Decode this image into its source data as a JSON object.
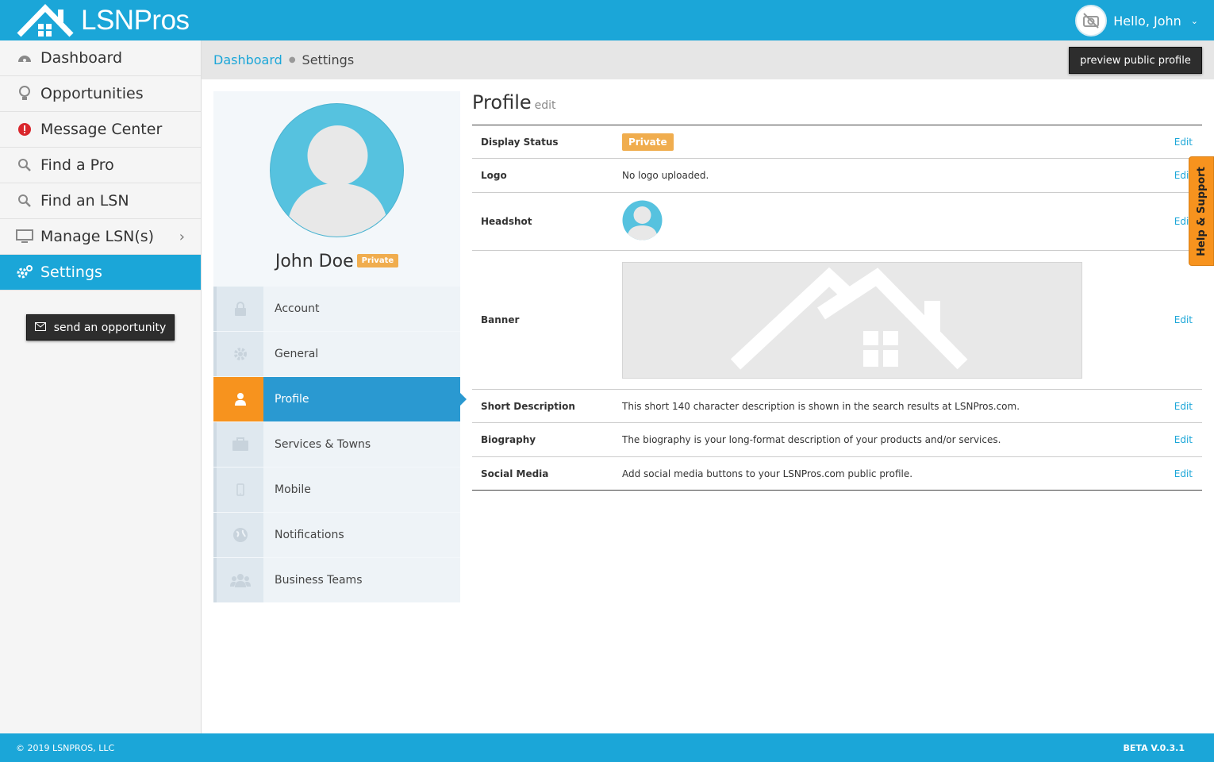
{
  "brand": {
    "name": "LSNPros"
  },
  "header": {
    "greeting": "Hello, John"
  },
  "sidebar": {
    "items": [
      {
        "label": "Dashboard",
        "icon": "dashboard-icon"
      },
      {
        "label": "Opportunities",
        "icon": "lightbulb-icon"
      },
      {
        "label": "Message Center",
        "icon": "alert-icon"
      },
      {
        "label": "Find a Pro",
        "icon": "search-icon"
      },
      {
        "label": "Find an LSN",
        "icon": "search-icon"
      },
      {
        "label": "Manage LSN(s)",
        "icon": "monitor-icon"
      },
      {
        "label": "Settings",
        "icon": "gears-icon",
        "active": true
      }
    ],
    "send_button": "send an opportunity"
  },
  "breadcrumb": {
    "parent": "Dashboard",
    "current": "Settings"
  },
  "preview_button": "preview public profile",
  "profile_panel": {
    "name": "John Doe",
    "status_badge": "Private",
    "menu": [
      {
        "label": "Account",
        "icon": "lock-icon"
      },
      {
        "label": "General",
        "icon": "gear-icon"
      },
      {
        "label": "Profile",
        "icon": "user-icon",
        "active": true
      },
      {
        "label": "Services & Towns",
        "icon": "briefcase-icon"
      },
      {
        "label": "Mobile",
        "icon": "mobile-icon"
      },
      {
        "label": "Notifications",
        "icon": "globe-icon"
      },
      {
        "label": "Business Teams",
        "icon": "users-icon"
      }
    ]
  },
  "content": {
    "title": "Profile",
    "title_edit": "edit",
    "edit_label": "Edit",
    "rows": {
      "display_status": {
        "label": "Display Status",
        "value": "Private"
      },
      "logo": {
        "label": "Logo",
        "value": "No logo uploaded."
      },
      "headshot": {
        "label": "Headshot"
      },
      "banner": {
        "label": "Banner"
      },
      "short_description": {
        "label": "Short Description",
        "value": "This short 140 character description is shown in the search results at LSNPros.com."
      },
      "biography": {
        "label": "Biography",
        "value": "The biography is your long-format description of your products and/or services."
      },
      "social_media": {
        "label": "Social Media",
        "value": "Add social media buttons to your LSNPros.com public profile."
      }
    }
  },
  "help_tab": "Help & Support",
  "footer": {
    "copyright": "© 2019 LSNPROS, LLC",
    "version": "BETA V.0.3.1"
  },
  "colors": {
    "primary": "#1ba6d8",
    "accent": "#f7931e",
    "badge": "#f0ad4e",
    "dark_button": "#2d2d2d"
  }
}
